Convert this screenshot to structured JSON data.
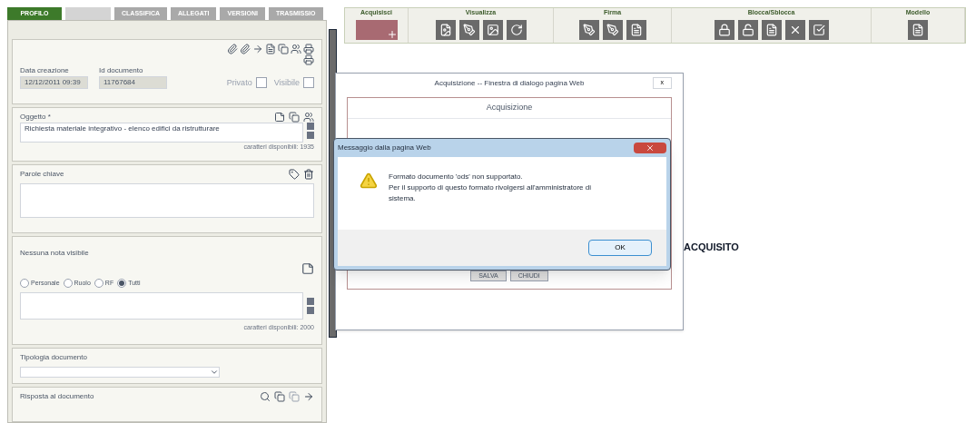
{
  "tabs": [
    {
      "label": "PROFILO",
      "selected": true
    },
    {
      "label": "CLASSIFICA",
      "selected": false
    },
    {
      "label": "ALLEGATI",
      "selected": false
    },
    {
      "label": "VERSIONI",
      "selected": false
    },
    {
      "label": "TRASMISSIO",
      "selected": false
    }
  ],
  "toolbar": {
    "groups": [
      {
        "label": "Acquisisci"
      },
      {
        "label": "Visualizza"
      },
      {
        "label": "Firma"
      },
      {
        "label": "Blocca/Sblocca"
      },
      {
        "label": "Modello"
      }
    ]
  },
  "profile": {
    "created_label": "Data creazione",
    "created_value": "12/12/2011 09:39",
    "id_label": "Id documento",
    "id_value": "11767684",
    "flags": [
      {
        "label": "Privato",
        "checked": false
      },
      {
        "label": "Visibile",
        "checked": false
      }
    ],
    "subject_label": "Oggetto *",
    "subject_value": "Richiesta materiale integrativo - elenco edifici da ristrutturare",
    "subject_counter": "caratteri disponibili: 1935",
    "keywords_label": "Parole chiave",
    "notes_label": "Nessuna nota visibile",
    "note_scopes": [
      {
        "label": "Personale",
        "selected": false
      },
      {
        "label": "Ruolo",
        "selected": false
      },
      {
        "label": "RF",
        "selected": false
      },
      {
        "label": "Tutti",
        "selected": true
      }
    ],
    "notes_counter": "caratteri disponibili: 2000",
    "type_label": "Tipologia documento",
    "reply_label": "Risposta al documento"
  },
  "acquisition_dialog": {
    "title": "Acquisizione -- Finestra di dialogo pagina Web",
    "close": "x",
    "header": "Acquisizione",
    "buttons": [
      "SALVA",
      "CHIUDI"
    ]
  },
  "status_text": "ACQUISITO",
  "message_box": {
    "title": "Messaggio dalla pagina Web",
    "lines": [
      "Formato documento 'ods' non supportato.",
      "Per il supporto di questo formato rivolgersi all'amministratore di sistema."
    ],
    "button": "OK"
  }
}
